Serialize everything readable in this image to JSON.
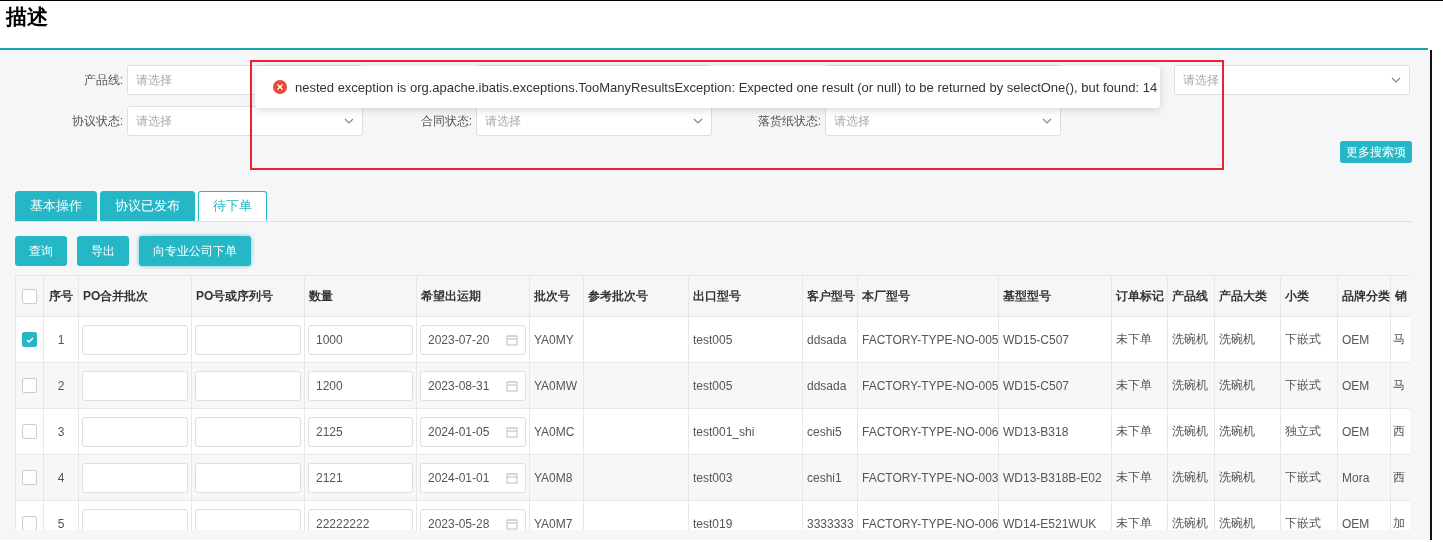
{
  "title": "描述",
  "filters": {
    "product_line": {
      "label": "产品线:",
      "placeholder": "请选择"
    },
    "fourth": {
      "placeholder": "请选择"
    },
    "row2": [
      {
        "label": "协议状态:",
        "placeholder": "请选择"
      },
      {
        "label": "合同状态:",
        "placeholder": "请选择"
      },
      {
        "label": "落货纸状态:",
        "placeholder": "请选择"
      }
    ],
    "more_button": "更多搜索项"
  },
  "toast": {
    "kind": "error",
    "message": "nested exception is org.apache.ibatis.exceptions.TooManyResultsException: Expected one result (or null) to be returned by selectOne(), but found: 14"
  },
  "tabs": [
    {
      "label": "基本操作",
      "selected": false
    },
    {
      "label": "协议已发布",
      "selected": false
    },
    {
      "label": "待下单",
      "selected": true
    }
  ],
  "actions": [
    "查询",
    "导出",
    "向专业公司下单"
  ],
  "table": {
    "all_checked": false,
    "columns": [
      "序号",
      "PO合并批次",
      "PO号或序列号",
      "数量",
      "希望出运期",
      "批次号",
      "参考批次号",
      "出口型号",
      "客户型号",
      "本厂型号",
      "基型型号",
      "订单标记",
      "产品线",
      "产品大类",
      "小类",
      "品牌分类",
      "销"
    ],
    "rows": [
      {
        "checked": true,
        "no": "1",
        "quantity": "1000",
        "date": "2023-07-20",
        "batch": "YA0MY",
        "export_model": "test005",
        "customer_model": "ddsada",
        "factory_model": "FACTORY-TYPE-NO-005",
        "base_model": "WD15-C507",
        "order_mark": "未下单",
        "product_line": "洗碗机",
        "category": "洗碗机",
        "subcategory": "下嵌式",
        "brand": "OEM",
        "column_18": "马"
      },
      {
        "checked": false,
        "no": "2",
        "quantity": "1200",
        "date": "2023-08-31",
        "batch": "YA0MW",
        "export_model": "test005",
        "customer_model": "ddsada",
        "factory_model": "FACTORY-TYPE-NO-005",
        "base_model": "WD15-C507",
        "order_mark": "未下单",
        "product_line": "洗碗机",
        "category": "洗碗机",
        "subcategory": "下嵌式",
        "brand": "OEM",
        "column_18": "马"
      },
      {
        "checked": false,
        "no": "3",
        "quantity": "2125",
        "date": "2024-01-05",
        "batch": "YA0MC",
        "export_model": "test001_shi",
        "customer_model": "ceshi5",
        "factory_model": "FACTORY-TYPE-NO-006",
        "base_model": "WD13-B318",
        "order_mark": "未下单",
        "product_line": "洗碗机",
        "category": "洗碗机",
        "subcategory": "独立式",
        "brand": "OEM",
        "column_18": "西"
      },
      {
        "checked": false,
        "no": "4",
        "quantity": "2121",
        "date": "2024-01-01",
        "batch": "YA0M8",
        "export_model": "test003",
        "customer_model": "ceshi1",
        "factory_model": "FACTORY-TYPE-NO-003",
        "base_model": "WD13-B318B-E02",
        "order_mark": "未下单",
        "product_line": "洗碗机",
        "category": "洗碗机",
        "subcategory": "下嵌式",
        "brand": "Mora",
        "column_18": "西"
      },
      {
        "checked": false,
        "no": "5",
        "quantity": "22222222",
        "date": "2023-05-28",
        "batch": "YA0M7",
        "export_model": "test019",
        "customer_model": "3333333",
        "factory_model": "FACTORY-TYPE-NO-006",
        "base_model": "WD14-E521WUK",
        "order_mark": "未下单",
        "product_line": "洗碗机",
        "category": "洗碗机",
        "subcategory": "下嵌式",
        "brand": "OEM",
        "column_18": "加"
      }
    ]
  }
}
